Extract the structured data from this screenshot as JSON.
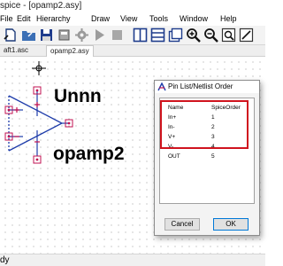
{
  "window": {
    "title": "spice - [opamp2.asy]"
  },
  "menu": [
    "File",
    "Edit",
    "Hierarchy",
    "Draw",
    "View",
    "Tools",
    "Window",
    "Help"
  ],
  "tabs": [
    {
      "label": "aft1.asc",
      "active": false
    },
    {
      "label": "opamp2.asy",
      "active": true
    }
  ],
  "canvas": {
    "instance_name": "Unnn",
    "symbol_name": "opamp2"
  },
  "dialog": {
    "title": "Pin List/Netlist Order",
    "columns": [
      "Name",
      "SpiceOrder"
    ],
    "rows": [
      {
        "name": "In+",
        "order": "1"
      },
      {
        "name": "In-",
        "order": "2"
      },
      {
        "name": "V+",
        "order": "3"
      },
      {
        "name": "V-",
        "order": "4"
      },
      {
        "name": "OUT",
        "order": "5"
      }
    ],
    "cancel_label": "Cancel",
    "ok_label": "OK"
  },
  "status": {
    "text": "dy"
  },
  "colors": {
    "highlight": "#d0141e",
    "symbol": "#1e3caa",
    "pin": "#c01050"
  }
}
